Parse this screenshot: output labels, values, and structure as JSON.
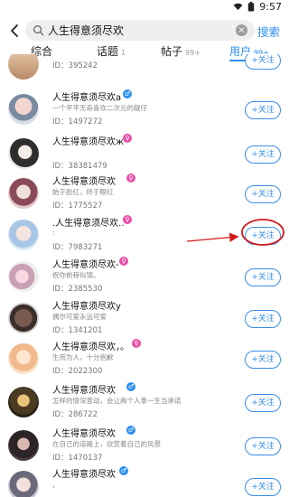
{
  "status": {
    "time": "9:57"
  },
  "search": {
    "query": "人生得意须尽欢",
    "button": "搜索"
  },
  "tabs": [
    {
      "label": "综合",
      "count": ""
    },
    {
      "label": "话题",
      "count": "1"
    },
    {
      "label": "帖子",
      "count": "99+"
    },
    {
      "label": "用户",
      "count": "99+"
    }
  ],
  "users": [
    {
      "name": "",
      "bio": "",
      "id": "ID：395242",
      "badge": ""
    },
    {
      "name": "人生得意须尽欢a",
      "bio": "一个平平无奇喜欢二次元的靓仔",
      "id": "ID：1497272",
      "badge": "blue"
    },
    {
      "name": "人生得意须尽欢ж",
      "bio": "",
      "id": "ID：38381479",
      "badge": "pink"
    },
    {
      "name": "人生得意须尽欢",
      "bio": "始于脸红，终于眼红",
      "id": "ID：1775527",
      "badge": "pink"
    },
    {
      "name": ".人生得意须尽欢..",
      "bio": ":",
      "id": "ID：7983271",
      "badge": "pink"
    },
    {
      "name": "人生得意须尽欢-",
      "bio": "祝你前程似锦。",
      "id": "ID：2385530",
      "badge": "pink"
    },
    {
      "name": "人生得意须尽欢y",
      "bio": "偶尔可爱永远可爱",
      "id": "ID：1341201",
      "badge": "pink"
    },
    {
      "name": "人生得意须尽欢，。",
      "bio": "生而为人，十分抱歉",
      "id": "ID：2022300",
      "badge": "pink"
    },
    {
      "name": "人生得意须尽欢",
      "bio": "怎样的情深意动，会让两个人拿一生当承诺",
      "id": "ID：286722",
      "badge": "blue"
    },
    {
      "name": "人生得意须尽欢",
      "bio": "在自己的道路上，欣赏着自己的风景",
      "id": "ID：1470137",
      "badge": "blue"
    },
    {
      "name": "人生得意须尽欢",
      "bio": "。",
      "id": "",
      "badge": "blue"
    }
  ],
  "follow_label": "+关注",
  "colors": {
    "accent": "#2b8ff0",
    "annotation": "#d11a1a",
    "badge_pink": "#e84fa8"
  }
}
